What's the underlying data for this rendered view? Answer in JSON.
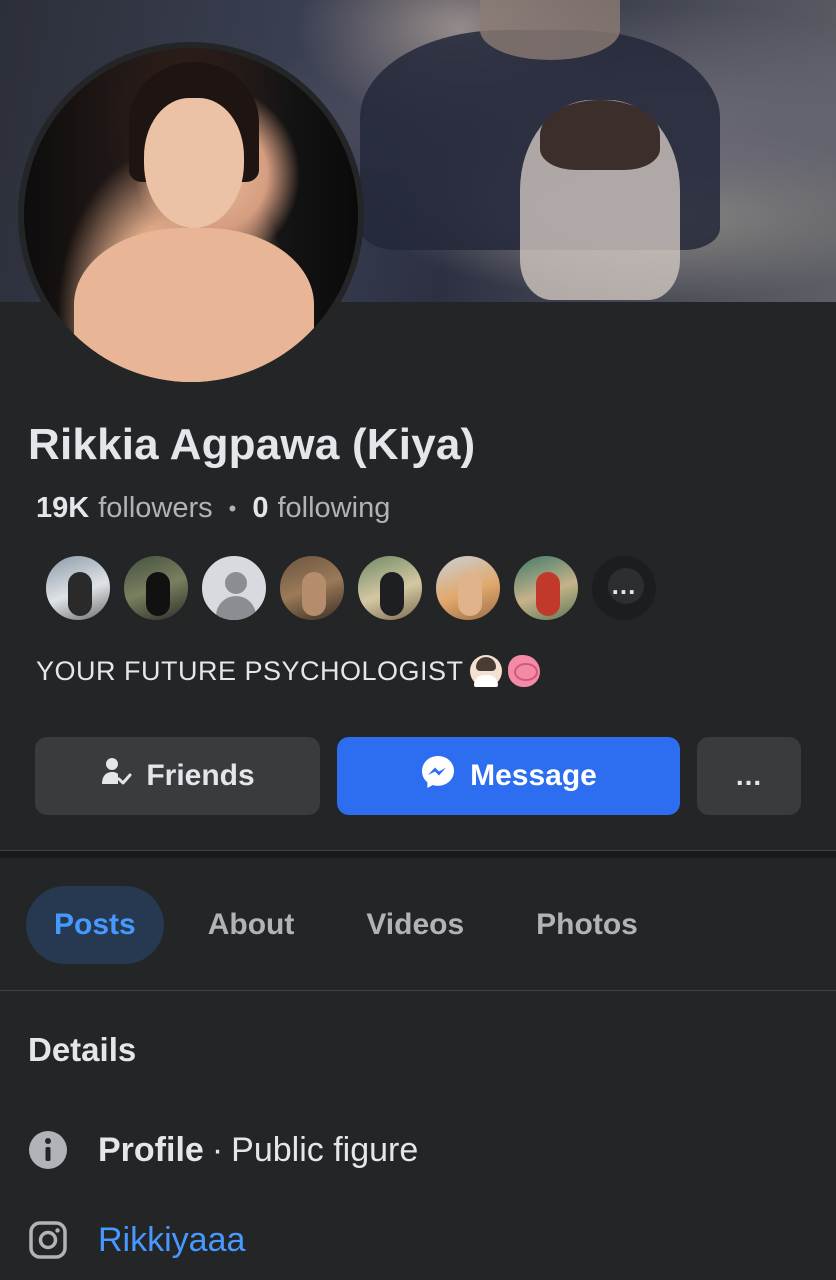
{
  "profile": {
    "name": "Rikkia Agpawa (Kiya)",
    "followers_count": "19K",
    "followers_label": "followers",
    "following_count": "0",
    "following_label": "following",
    "separator": "•",
    "more_followers_label": "...",
    "bio": "YOUR FUTURE PSYCHOLOGIST"
  },
  "actions": {
    "friends_label": "Friends",
    "message_label": "Message",
    "more_label": "..."
  },
  "tabs": [
    {
      "label": "Posts",
      "active": true
    },
    {
      "label": "About",
      "active": false
    },
    {
      "label": "Videos",
      "active": false
    },
    {
      "label": "Photos",
      "active": false
    }
  ],
  "details": {
    "title": "Details",
    "profile_label": "Profile",
    "profile_sep": "·",
    "profile_value": "Public figure",
    "instagram_handle": "Rikkiyaaa"
  },
  "colors": {
    "background": "#242526",
    "accent": "#2d6ef0",
    "link": "#4599ff",
    "active_tab_bg": "#263951"
  },
  "icons": {
    "friends": "friend-check-icon",
    "message": "messenger-icon",
    "info": "info-icon",
    "instagram": "instagram-icon",
    "bio_emoji_1": "psychologist-emoji",
    "bio_emoji_2": "brain-emoji"
  }
}
